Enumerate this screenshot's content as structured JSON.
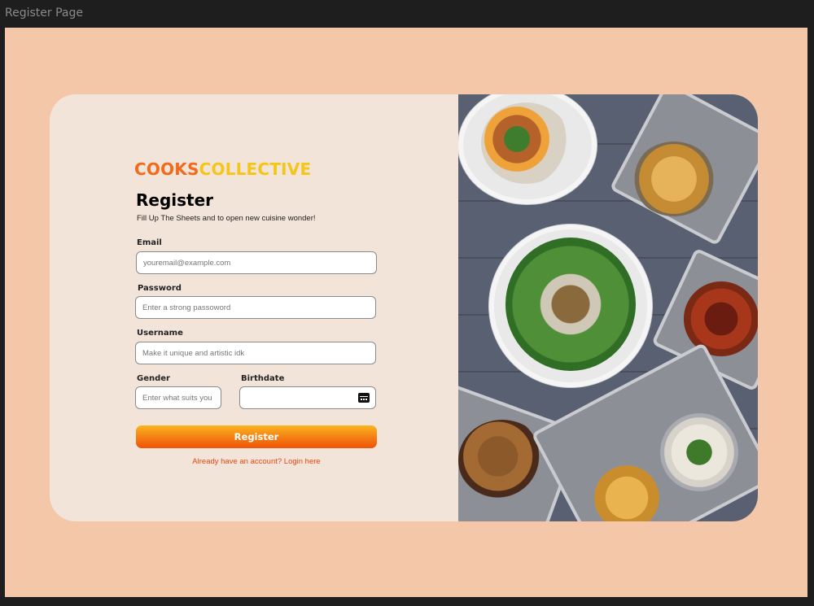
{
  "window": {
    "title": "Register Page"
  },
  "brand": {
    "part1": "COOKS",
    "part2": "COLLECTIVE"
  },
  "form": {
    "title": "Register",
    "subtitle": "Fill Up The Sheets and to open new cuisine wonder!",
    "email": {
      "label": "Email",
      "placeholder": "youremail@example.com",
      "value": ""
    },
    "password": {
      "label": "Password",
      "placeholder": "Enter a strong passoword",
      "value": ""
    },
    "username": {
      "label": "Username",
      "placeholder": "Make it unique and artistic idk",
      "value": ""
    },
    "gender": {
      "label": "Gender",
      "placeholder": "Enter what suits you",
      "value": ""
    },
    "birthdate": {
      "label": "Birthdate",
      "value": "",
      "icon": "calendar-icon"
    },
    "submit_label": "Register",
    "login_link": "Already have an account? Login here"
  },
  "image": {
    "description_icon": "food-photo",
    "background_color": "#596071"
  },
  "colors": {
    "canvas": "#f3c7a8",
    "card": "#f3e4da",
    "brand_orange": "#f26a1b",
    "brand_yellow": "#f5c518",
    "link": "#e8470e"
  }
}
